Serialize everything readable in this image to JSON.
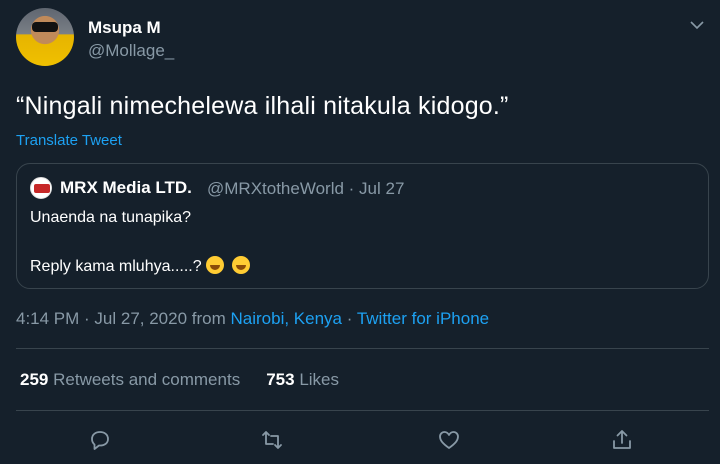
{
  "author": {
    "display_name": "Msupa M",
    "handle": "@Mollage_"
  },
  "tweet": {
    "text": "“Ningali nimechelewa ilhali nitakula kidogo.”",
    "translate_label": "Translate Tweet"
  },
  "quoted": {
    "display_name": "MRX Media LTD.",
    "handle_date": "@MRXtotheWorld · Jul 27",
    "line1": "Unaenda na tunapika?",
    "line2": "Reply kama mluhya.....?"
  },
  "meta": {
    "timestamp": "4:14 PM · Jul 27, 2020 from ",
    "location": "Nairobi, Kenya",
    "separator": " · ",
    "source": "Twitter for iPhone"
  },
  "stats": {
    "retweets_count": "259",
    "retweets_label": "Retweets and comments",
    "likes_count": "753",
    "likes_label": "Likes"
  },
  "icons": [
    "chevron-down-icon",
    "reply-icon",
    "retweet-icon",
    "like-icon",
    "share-icon"
  ],
  "colors": {
    "background": "#15202b",
    "accent": "#1da1f2",
    "muted": "#8899a6",
    "border": "#38444d"
  }
}
